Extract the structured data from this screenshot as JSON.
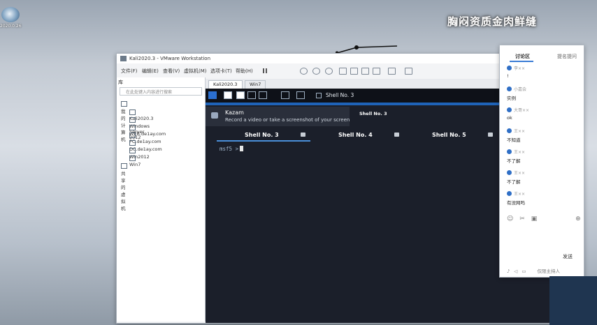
{
  "desktop": {
    "icon_label": "2020.0.26",
    "overlay_title": "胸闷资质金肉鲜缝"
  },
  "vmware": {
    "title": "Kali2020.3 - VMware Workstation",
    "menu": [
      "文件(F)",
      "编辑(E)",
      "查看(V)",
      "虚拟机(M)",
      "选项卡(T)",
      "帮助(H)"
    ],
    "library": {
      "header": "库",
      "search_placeholder": "在此处键入内容进行搜索",
      "root": "我的计算机",
      "vms": [
        "Kali2020.3",
        "Windows Server 2012",
        "WEB.de1ay.com",
        "PC.de1ay.com",
        "DC.de1ay.com",
        "Win2012",
        "Win7"
      ],
      "shared": "共享的虚拟机"
    },
    "tabs": [
      "Kali2020.3",
      "Win7"
    ]
  },
  "kali": {
    "panel_label": "Shell No. 3",
    "kazam": {
      "title": "Kazam",
      "description": "Record a video or take a screenshot of your screen"
    },
    "side_label": "Shell No. 3",
    "terminal_tabs": [
      "Shell No. 3",
      "Shell No. 4",
      "Shell No. 5"
    ],
    "prompt": "msf5 >"
  },
  "chat": {
    "tab_discussion": "讨论区",
    "tab_other": "提名提问",
    "messages": [
      {
        "user": "李××",
        "text": "!"
      },
      {
        "user": "小嘉会",
        "text": "实例"
      },
      {
        "user": "大哥××",
        "text": "ok"
      },
      {
        "user": "王××",
        "text": "不知道"
      },
      {
        "user": "王××",
        "text": "不了解"
      },
      {
        "user": "王××",
        "text": "不了解"
      },
      {
        "user": "王××",
        "text": "有没网吗"
      }
    ],
    "send_label": "发送",
    "bottom_label": "仅限主持人"
  },
  "colors": {
    "kali_bg": "#1b1f2a",
    "accent_blue": "#1f63b8",
    "tab_underline": "#4a8fd9"
  }
}
